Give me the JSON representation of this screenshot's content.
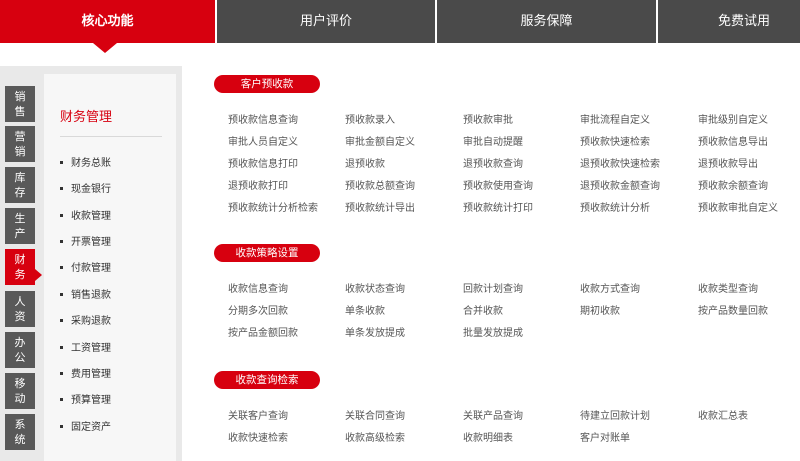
{
  "tabs": [
    {
      "label": "核心功能",
      "active": true
    },
    {
      "label": "用户评价",
      "active": false
    },
    {
      "label": "服务保障",
      "active": false
    },
    {
      "label": "免费试用",
      "active": false
    }
  ],
  "categories": [
    {
      "label": "销售",
      "active": false
    },
    {
      "label": "营销",
      "active": false
    },
    {
      "label": "库存",
      "active": false
    },
    {
      "label": "生产",
      "active": false
    },
    {
      "label": "财务",
      "active": true
    },
    {
      "label": "人资",
      "active": false
    },
    {
      "label": "办公",
      "active": false
    },
    {
      "label": "移动",
      "active": false
    },
    {
      "label": "系统",
      "active": false
    }
  ],
  "submenu": {
    "title": "财务管理",
    "items": [
      "财务总账",
      "现金银行",
      "收款管理",
      "开票管理",
      "付款管理",
      "销售退款",
      "采购退款",
      "工资管理",
      "费用管理",
      "预算管理",
      "固定资产"
    ]
  },
  "sections": [
    {
      "title": "客户预收款",
      "rows": [
        [
          "预收款信息查询",
          "预收款录入",
          "预收款审批",
          "审批流程自定义",
          "审批级别自定义"
        ],
        [
          "审批人员自定义",
          "审批金额自定义",
          "审批自动提醒",
          "预收款快速检索",
          "预收款信息导出"
        ],
        [
          "预收款信息打印",
          "退预收款",
          "退预收款查询",
          "退预收款快速检索",
          "退预收款导出"
        ],
        [
          "退预收款打印",
          "预收款总额查询",
          "预收款使用查询",
          "退预收款金额查询",
          "预收款余额查询"
        ],
        [
          "预收款统计分析检索",
          "预收款统计导出",
          "预收款统计打印",
          "预收款统计分析",
          "预收款审批自定义"
        ]
      ]
    },
    {
      "title": "收款策略设置",
      "rows": [
        [
          "收款信息查询",
          "收款状态查询",
          "回款计划查询",
          "收款方式查询",
          "收款类型查询"
        ],
        [
          "分期多次回款",
          "单条收款",
          "合并收款",
          "期初收款",
          "按产品数量回款"
        ],
        [
          "按产品金额回款",
          "单条发放提成",
          "批量发放提成"
        ]
      ]
    },
    {
      "title": "收款查询检索",
      "rows": [
        [
          "关联客户查询",
          "关联合同查询",
          "关联产品查询",
          "待建立回款计划",
          "收款汇总表"
        ],
        [
          "收款快速检索",
          "收款高级检索",
          "收款明细表",
          "客户对账单"
        ]
      ]
    }
  ],
  "colors": {
    "accent": "#d7000f",
    "tab_inactive": "#4a4a4a",
    "category_bg": "#595959"
  }
}
